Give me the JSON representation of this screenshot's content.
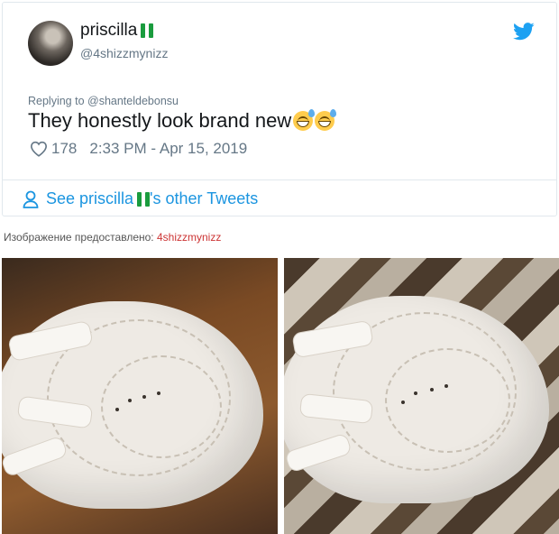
{
  "tweet": {
    "display_name": "priscilla",
    "handle": "@4shizzmynizz",
    "replying_to": "Replying to @shanteldebonsu",
    "text": "They honestly look brand new",
    "likes": "178",
    "timestamp": "2:33 PM - Apr 15, 2019",
    "other_tweets_prefix": "See priscilla",
    "other_tweets_suffix": "'s other Tweets"
  },
  "credit": {
    "label": "Изображение предоставлено:",
    "source": "4shizzmynizz"
  },
  "colors": {
    "link": "#1b95e0",
    "muted": "#657786",
    "flag_green": "#1a9c3e",
    "credit_link": "#cc3333"
  },
  "icons": [
    "avatar",
    "nigeria-flag-icon",
    "twitter-bird-icon",
    "sweat-smile-emoji-icon",
    "heart-icon",
    "person-icon"
  ]
}
